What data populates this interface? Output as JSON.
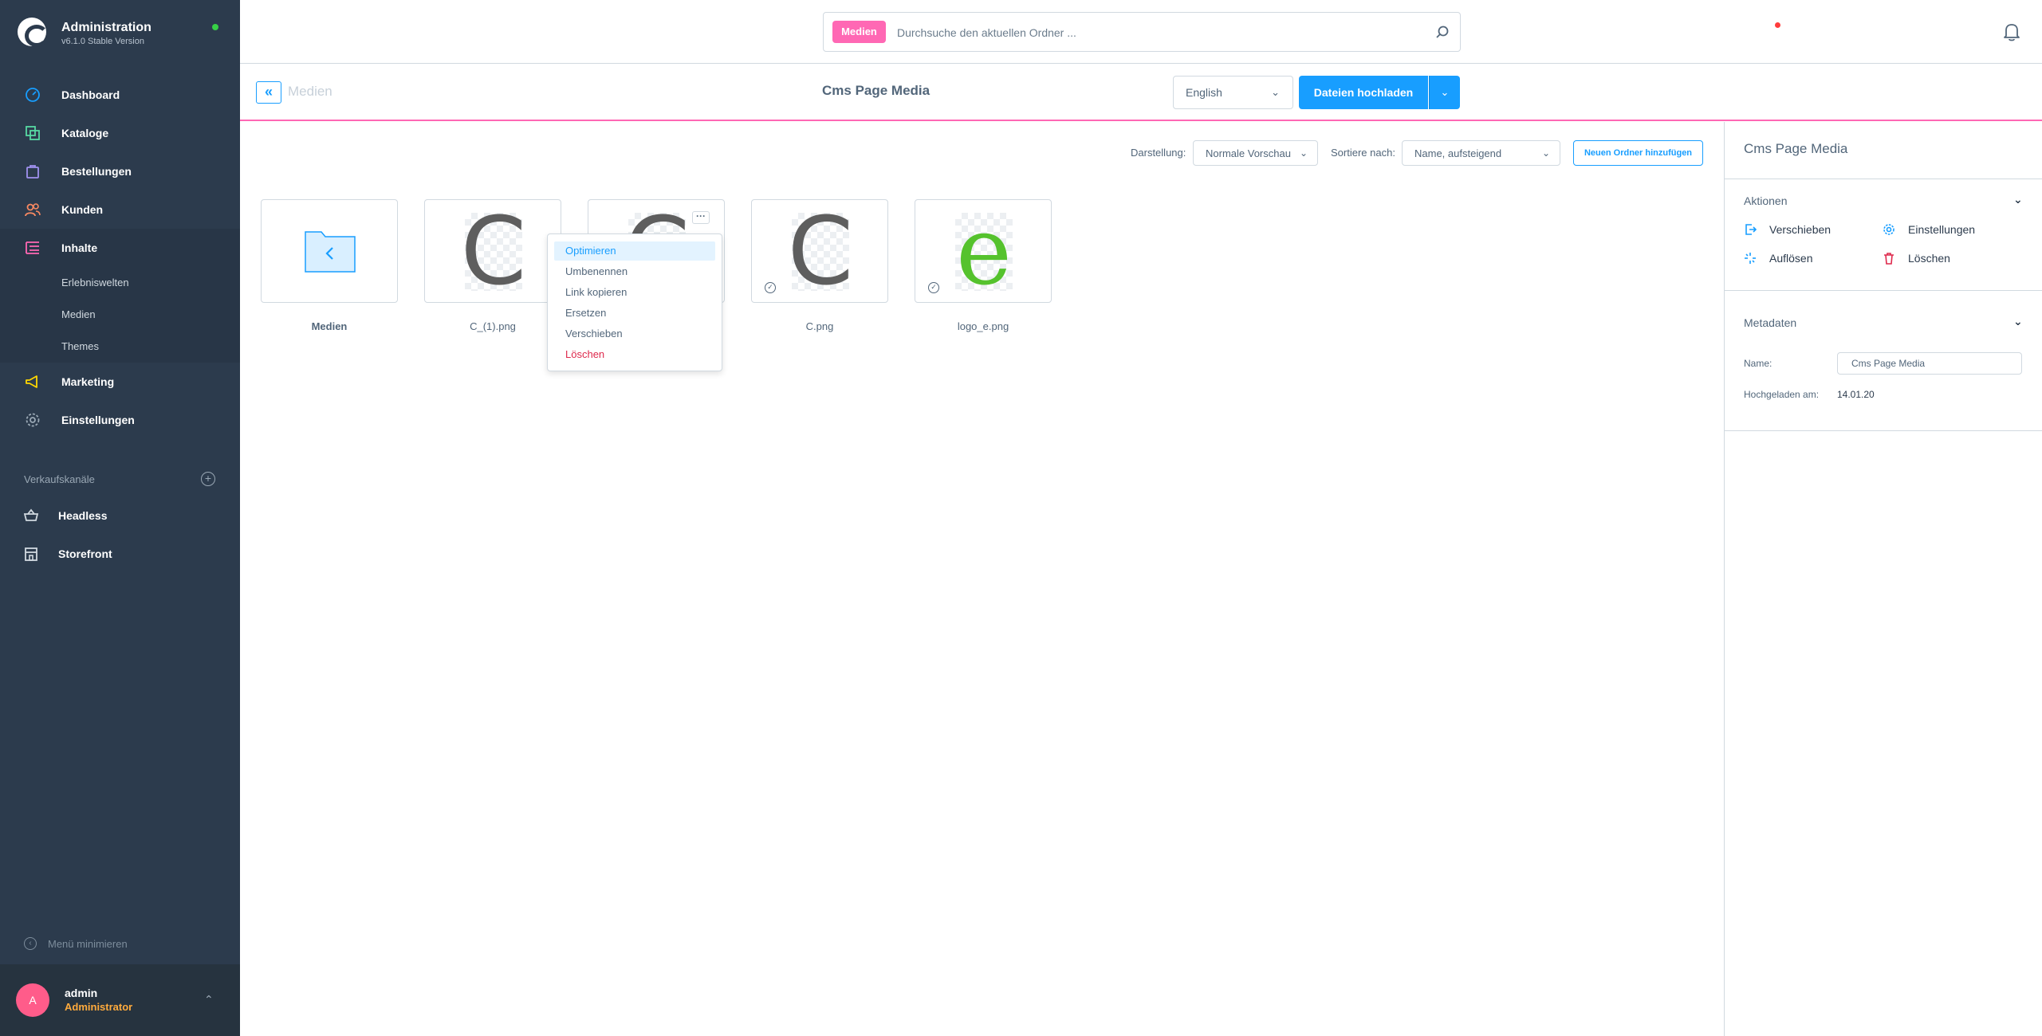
{
  "app": {
    "title": "Administration",
    "version": "v6.1.0 Stable Version"
  },
  "nav": {
    "items": [
      {
        "label": "Dashboard",
        "icon": "gauge-icon",
        "color": "#189eff"
      },
      {
        "label": "Kataloge",
        "icon": "catalog-icon",
        "color": "#57d9a3"
      },
      {
        "label": "Bestellungen",
        "icon": "bag-icon",
        "color": "#a092f0"
      },
      {
        "label": "Kunden",
        "icon": "users-icon",
        "color": "#f88962"
      },
      {
        "label": "Inhalte",
        "icon": "content-icon",
        "color": "#ff68b4"
      },
      {
        "label": "Marketing",
        "icon": "megaphone-icon",
        "color": "#ffd700"
      },
      {
        "label": "Einstellungen",
        "icon": "gear-icon",
        "color": "#9aa8b5"
      }
    ],
    "sub_items": [
      "Erlebniswelten",
      "Medien",
      "Themes"
    ],
    "sales_channels_title": "Verkaufskanäle",
    "sales_channels": [
      {
        "label": "Headless",
        "icon": "basket-icon"
      },
      {
        "label": "Storefront",
        "icon": "storefront-icon"
      }
    ],
    "minimize_label": "Menü minimieren"
  },
  "user": {
    "initial": "A",
    "name": "admin",
    "role": "Administrator"
  },
  "search": {
    "tag": "Medien",
    "placeholder": "Durchsuche den aktuellen Ordner ..."
  },
  "smartbar": {
    "back_label": "Medien",
    "title": "Cms Page Media",
    "language": "English",
    "upload_label": "Dateien hochladen"
  },
  "toolbar": {
    "view_label": "Darstellung:",
    "view_value": "Normale Vorschau",
    "sort_label": "Sortiere nach:",
    "sort_value": "Name, aufsteigend",
    "new_folder_label": "Neuen Ordner hinzufügen"
  },
  "media": [
    {
      "name": "Medien",
      "type": "folder"
    },
    {
      "name": "C_(1).png",
      "type": "image",
      "letter": "C"
    },
    {
      "name": "",
      "type": "image",
      "letter": "C"
    },
    {
      "name": "C.png",
      "type": "image",
      "letter": "C"
    },
    {
      "name": "logo_e.png",
      "type": "image",
      "letter": "e"
    }
  ],
  "context_menu": {
    "items": [
      "Optimieren",
      "Umbenennen",
      "Link kopieren",
      "Ersetzen",
      "Verschieben",
      "Löschen"
    ]
  },
  "side_panel": {
    "title": "Cms Page Media",
    "actions_title": "Aktionen",
    "actions": [
      "Verschieben",
      "Einstellungen",
      "Auflösen",
      "Löschen"
    ],
    "metadata_title": "Metadaten",
    "name_label": "Name:",
    "name_value": "Cms Page Media",
    "uploaded_label": "Hochgeladen am:",
    "uploaded_value": "14.01.20"
  },
  "colors": {
    "accent": "#189eff",
    "pink": "#ff68b4",
    "danger": "#de294c",
    "sidebar": "#2c3b4d"
  }
}
